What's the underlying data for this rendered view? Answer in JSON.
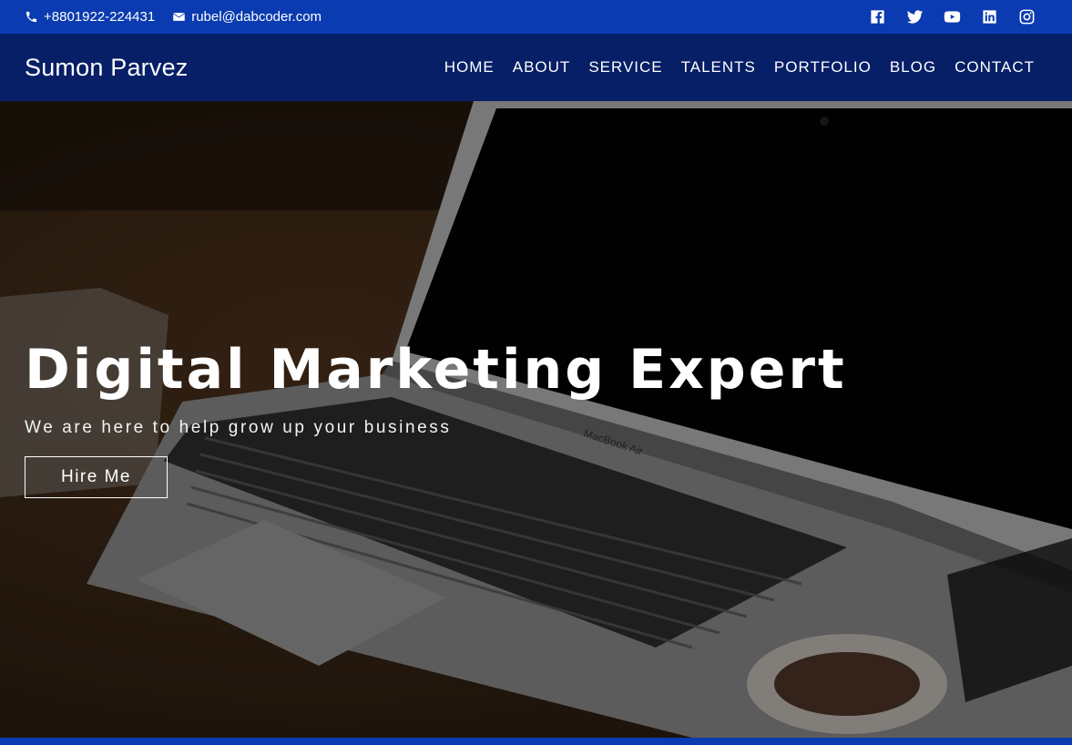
{
  "topbar": {
    "phone": "+8801922-224431",
    "email": "rubel@dabcoder.com",
    "socials": [
      "facebook-icon",
      "twitter-icon",
      "youtube-icon",
      "linkedin-icon",
      "instagram-icon"
    ]
  },
  "nav": {
    "brand": "Sumon Parvez",
    "items": [
      "HOME",
      "ABOUT",
      "SERVICE",
      "TALENTS",
      "PORTFOLIO",
      "BLOG",
      "CONTACT"
    ]
  },
  "hero": {
    "title": "Digital Marketing Expert",
    "subtitle": "We are here to help grow up your business",
    "cta": "Hire Me",
    "laptop_label": "MacBook Air"
  },
  "colors": {
    "topbar": "#0a3bb0",
    "navbar": "#061f66",
    "accent": "#0a3bb0"
  }
}
